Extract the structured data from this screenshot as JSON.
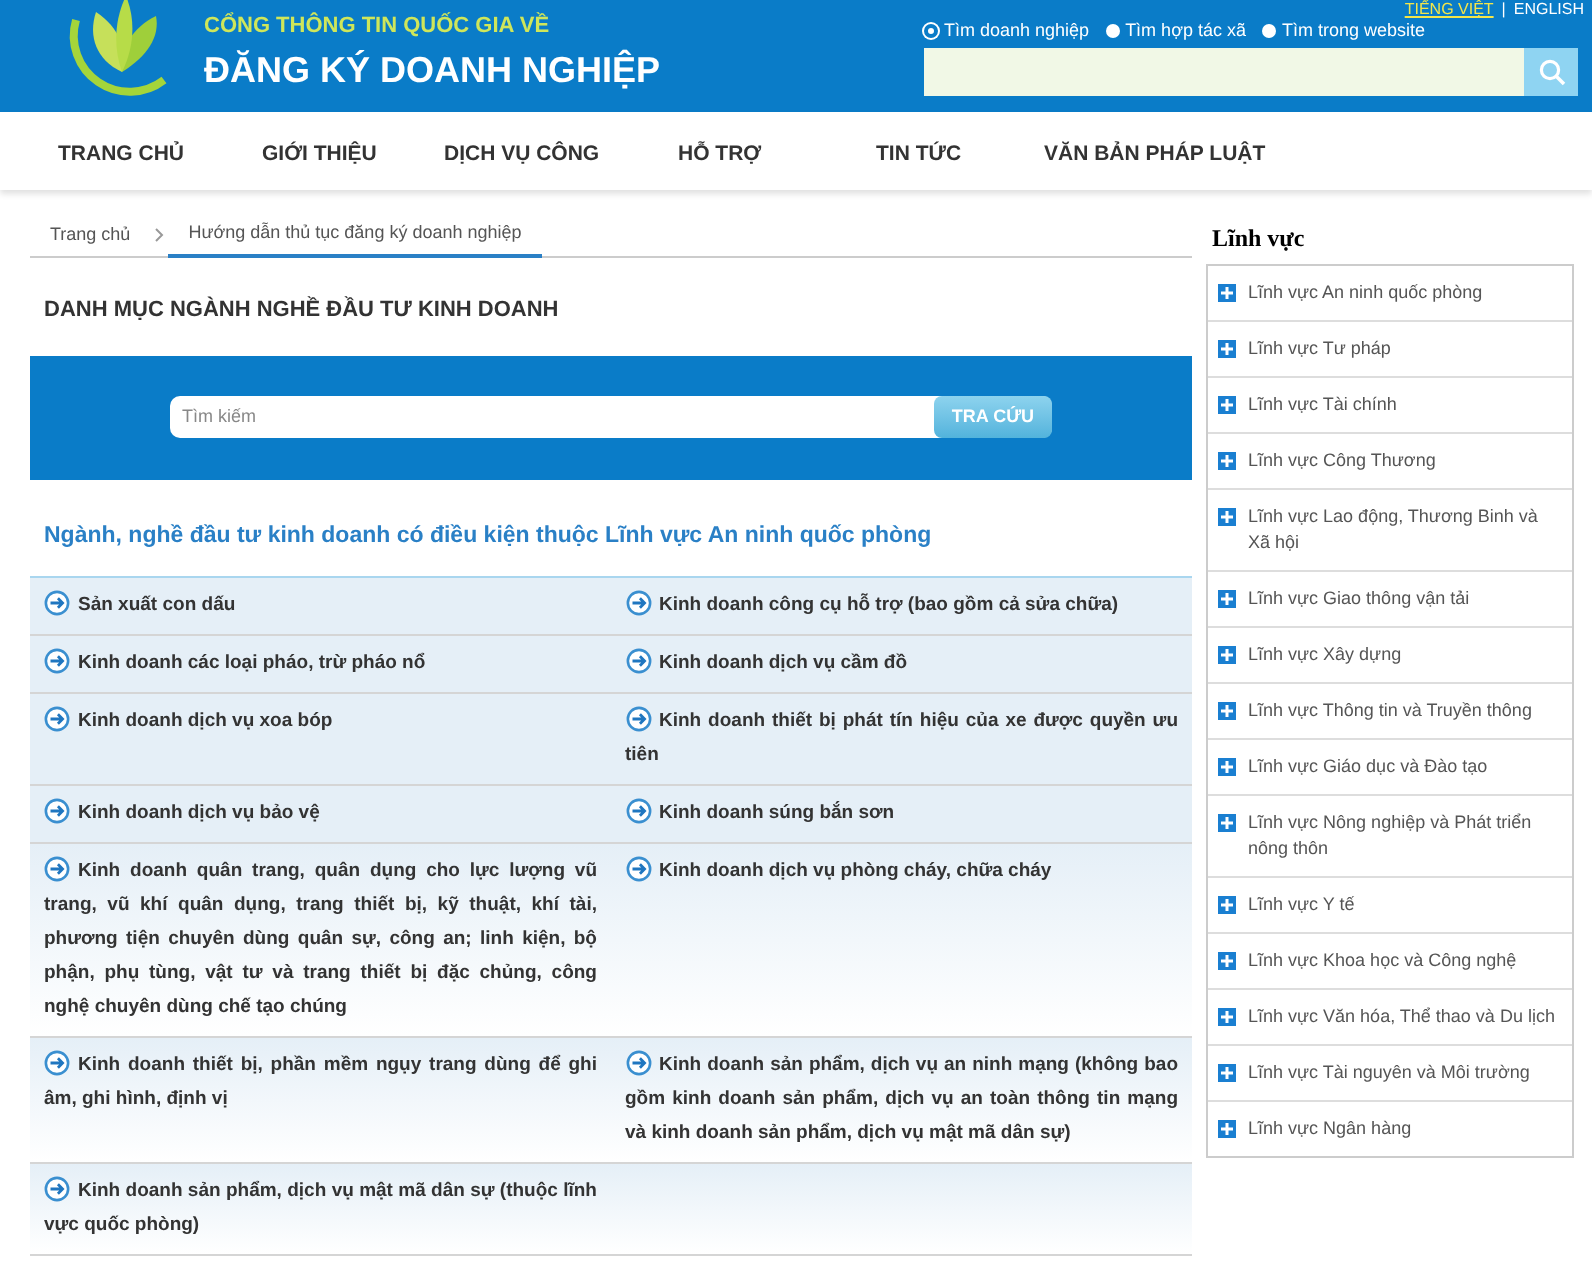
{
  "header": {
    "subtitle": "CỔNG THÔNG TIN QUỐC GIA VỀ",
    "title": "ĐĂNG KÝ DOANH NGHIỆP",
    "language_separator": "|",
    "languages": [
      {
        "label": "TIẾNG VIỆT",
        "selected": true
      },
      {
        "label": "ENGLISH",
        "selected": false
      }
    ],
    "search_scopes": [
      {
        "label": "Tìm doanh nghiệp",
        "selected": true
      },
      {
        "label": "Tìm hợp tác xã",
        "selected": false
      },
      {
        "label": "Tìm trong website",
        "selected": false
      }
    ]
  },
  "nav": [
    {
      "label": "TRANG CHỦ"
    },
    {
      "label": "GIỚI THIỆU"
    },
    {
      "label": "DỊCH VỤ CÔNG"
    },
    {
      "label": "HỖ TRỢ"
    },
    {
      "label": "TIN TỨC"
    },
    {
      "label": "VĂN BẢN PHÁP LUẬT"
    }
  ],
  "breadcrumb": [
    {
      "label": "Trang chủ"
    },
    {
      "label": "Hướng dẫn thủ tục đăng ký doanh nghiệp"
    }
  ],
  "page_title": "DANH MỤC NGÀNH NGHỀ ĐẦU TƯ KINH DOANH",
  "search": {
    "placeholder": "Tìm kiếm",
    "button": "TRA CỨU"
  },
  "section_title": "Ngành, nghề đầu tư kinh doanh có điều kiện thuộc Lĩnh vực An ninh quốc phòng",
  "rows": [
    {
      "cells": [
        "Sản xuất con dấu",
        "Kinh doanh công cụ hỗ trợ (bao gồm cả sửa chữa)"
      ]
    },
    {
      "cells": [
        "Kinh doanh các loại pháo, trừ pháo nổ",
        "Kinh doanh dịch vụ cầm đồ"
      ]
    },
    {
      "cells": [
        "Kinh doanh dịch vụ xoa bóp",
        "Kinh doanh thiết bị phát tín hiệu của xe được quyền ưu tiên"
      ]
    },
    {
      "cells": [
        "Kinh doanh dịch vụ bảo vệ",
        "Kinh doanh súng bắn sơn"
      ]
    },
    {
      "cells": [
        "Kinh doanh quân trang, quân dụng cho lực lượng vũ trang, vũ khí quân dụng, trang thiết bị, kỹ thuật, khí tài, phương tiện chuyên dùng quân sự, công an; linh kiện, bộ phận, phụ tùng, vật tư và trang thiết bị đặc chủng, công nghệ chuyên dùng chế tạo chúng",
        "Kinh doanh dịch vụ phòng cháy, chữa cháy"
      ]
    },
    {
      "cells": [
        "Kinh doanh thiết bị, phần mềm ngụy trang dùng để ghi âm, ghi hình, định vị",
        "Kinh doanh sản phẩm, dịch vụ an ninh mạng (không bao gồm kinh doanh sản phẩm, dịch vụ an toàn thông tin mạng và kinh doanh sản phẩm, dịch vụ mật mã dân sự)"
      ]
    },
    {
      "cells": [
        "Kinh doanh sản phẩm, dịch vụ mật mã dân sự (thuộc lĩnh vực quốc phòng)"
      ]
    }
  ],
  "sidebar": {
    "title": "Lĩnh vực",
    "items": [
      {
        "label": "Lĩnh vực An ninh quốc phòng"
      },
      {
        "label": "Lĩnh vực Tư pháp"
      },
      {
        "label": "Lĩnh vực Tài chính"
      },
      {
        "label": "Lĩnh vực Công Thương"
      },
      {
        "label": "Lĩnh vực Lao động, Thương Binh và Xã hội"
      },
      {
        "label": "Lĩnh vực Giao thông vận tải"
      },
      {
        "label": "Lĩnh vực Xây dựng"
      },
      {
        "label": "Lĩnh vực Thông tin và Truyền thông"
      },
      {
        "label": "Lĩnh vực Giáo dục và Đào tạo"
      },
      {
        "label": "Lĩnh vực Nông nghiệp và Phát triển nông thôn"
      },
      {
        "label": "Lĩnh vực Y tế"
      },
      {
        "label": "Lĩnh vực Khoa học và Công nghệ"
      },
      {
        "label": "Lĩnh vực Văn hóa, Thể thao và Du lịch"
      },
      {
        "label": "Lĩnh vực Tài nguyên và Môi trường"
      },
      {
        "label": "Lĩnh vực Ngân hàng"
      }
    ]
  }
}
